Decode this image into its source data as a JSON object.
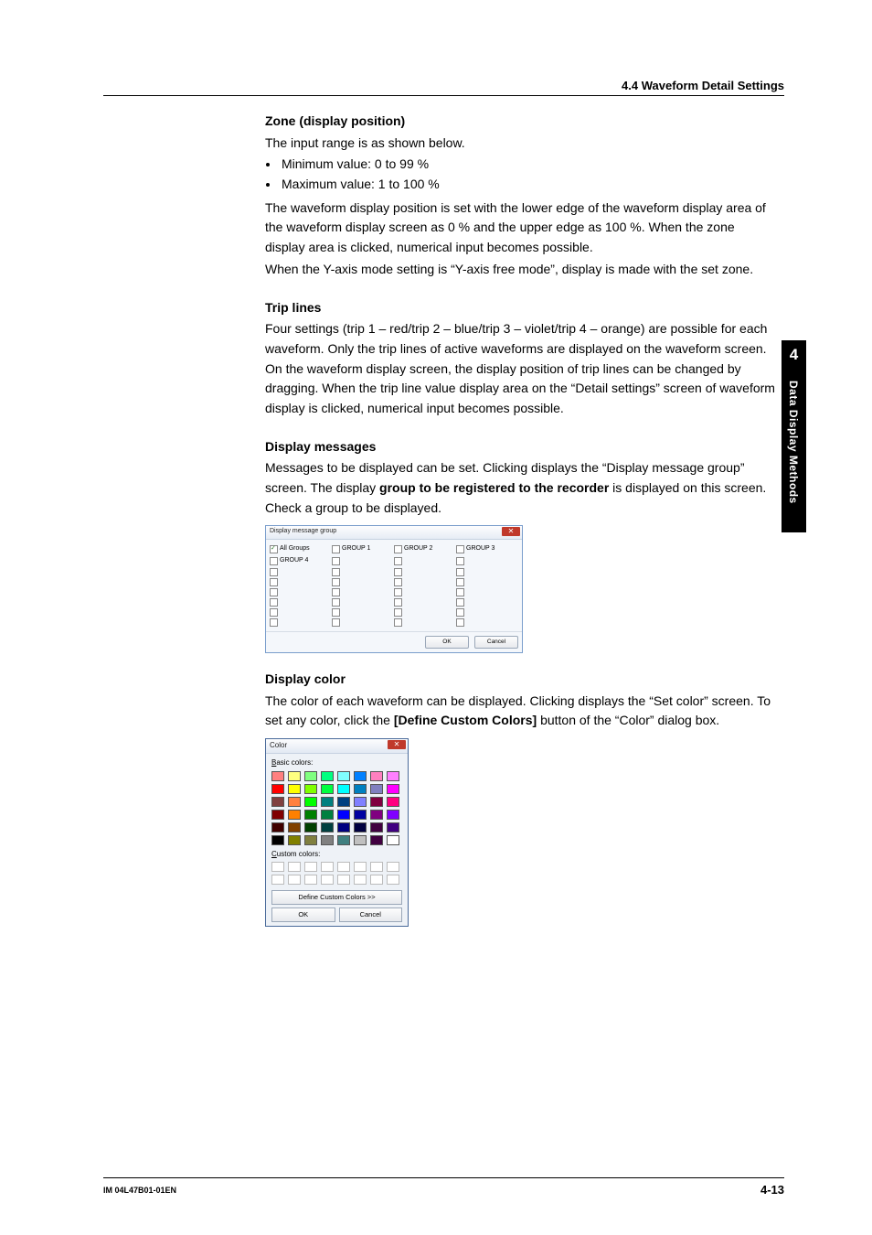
{
  "header": {
    "section": "4.4  Waveform Detail Settings"
  },
  "side_tab": {
    "chapter_num": "4",
    "chapter_title": "Data Display Methods"
  },
  "sections": {
    "zone": {
      "heading": "Zone (display position)",
      "intro": "The input range is as shown below.",
      "bullets": [
        "Minimum value: 0 to 99 %",
        "Maximum value: 1 to 100 %"
      ],
      "p1": "The waveform display position is set with the lower edge of the waveform display area of the waveform display screen as 0 % and the upper edge as 100 %. When the zone display area is clicked, numerical input becomes possible.",
      "p2": "When the Y-axis mode setting is “Y-axis free mode”, display is made with the set zone."
    },
    "triplines": {
      "heading": "Trip lines",
      "p1": "Four settings (trip 1 – red/trip 2 – blue/trip 3 – violet/trip 4 – orange) are possible for each waveform. Only the trip lines of active waveforms are displayed on the waveform screen. On the waveform display screen, the display position of trip lines can be changed by dragging. When the trip line value display area on the “Detail settings” screen of waveform display is clicked, numerical input becomes possible."
    },
    "messages": {
      "heading": "Display messages",
      "p1_a": "Messages to be displayed can be set. Clicking displays the “Display message group” screen. The display ",
      "p1_bold": "group to be registered to the recorder",
      "p1_b": " is displayed on this screen. Check a group to be displayed."
    },
    "color": {
      "heading": "Display color",
      "p1_a": "The color of each waveform can be displayed. Clicking displays the “Set color” screen. To set any color, click the ",
      "p1_bold": "[Define Custom Colors]",
      "p1_b": " button of the “Color” dialog box."
    }
  },
  "dlg_group": {
    "title": "Display message group",
    "close": "✕",
    "row1": [
      "All Groups",
      "GROUP 1",
      "GROUP 2",
      "GROUP 3"
    ],
    "row2": [
      "GROUP 4"
    ],
    "ok": "OK",
    "cancel": "Cancel"
  },
  "dlg_color": {
    "title": "Color",
    "close": "✕",
    "basic_label_u": "B",
    "basic_label_rest": "asic colors:",
    "basic_colors": [
      "#ff8080",
      "#ffff80",
      "#80ff80",
      "#00ff80",
      "#80ffff",
      "#0080ff",
      "#ff80c0",
      "#ff80ff",
      "#ff0000",
      "#ffff00",
      "#80ff00",
      "#00ff40",
      "#00ffff",
      "#0080c0",
      "#8080c0",
      "#ff00ff",
      "#804040",
      "#ff8040",
      "#00ff00",
      "#008080",
      "#004080",
      "#8080ff",
      "#800040",
      "#ff0080",
      "#800000",
      "#ff8000",
      "#008000",
      "#008040",
      "#0000ff",
      "#0000a0",
      "#800080",
      "#8000ff",
      "#400000",
      "#804000",
      "#004000",
      "#004040",
      "#000080",
      "#000040",
      "#400040",
      "#400080",
      "#000000",
      "#808000",
      "#808040",
      "#808080",
      "#408080",
      "#c0c0c0",
      "#400040",
      "#ffffff"
    ],
    "custom_label_u": "C",
    "custom_label_rest": "ustom colors:",
    "define_u": "D",
    "define_rest": "efine Custom Colors >>",
    "ok": "OK",
    "cancel": "Cancel"
  },
  "footer": {
    "doc_id": "IM 04L47B01-01EN",
    "page": "4-13"
  }
}
